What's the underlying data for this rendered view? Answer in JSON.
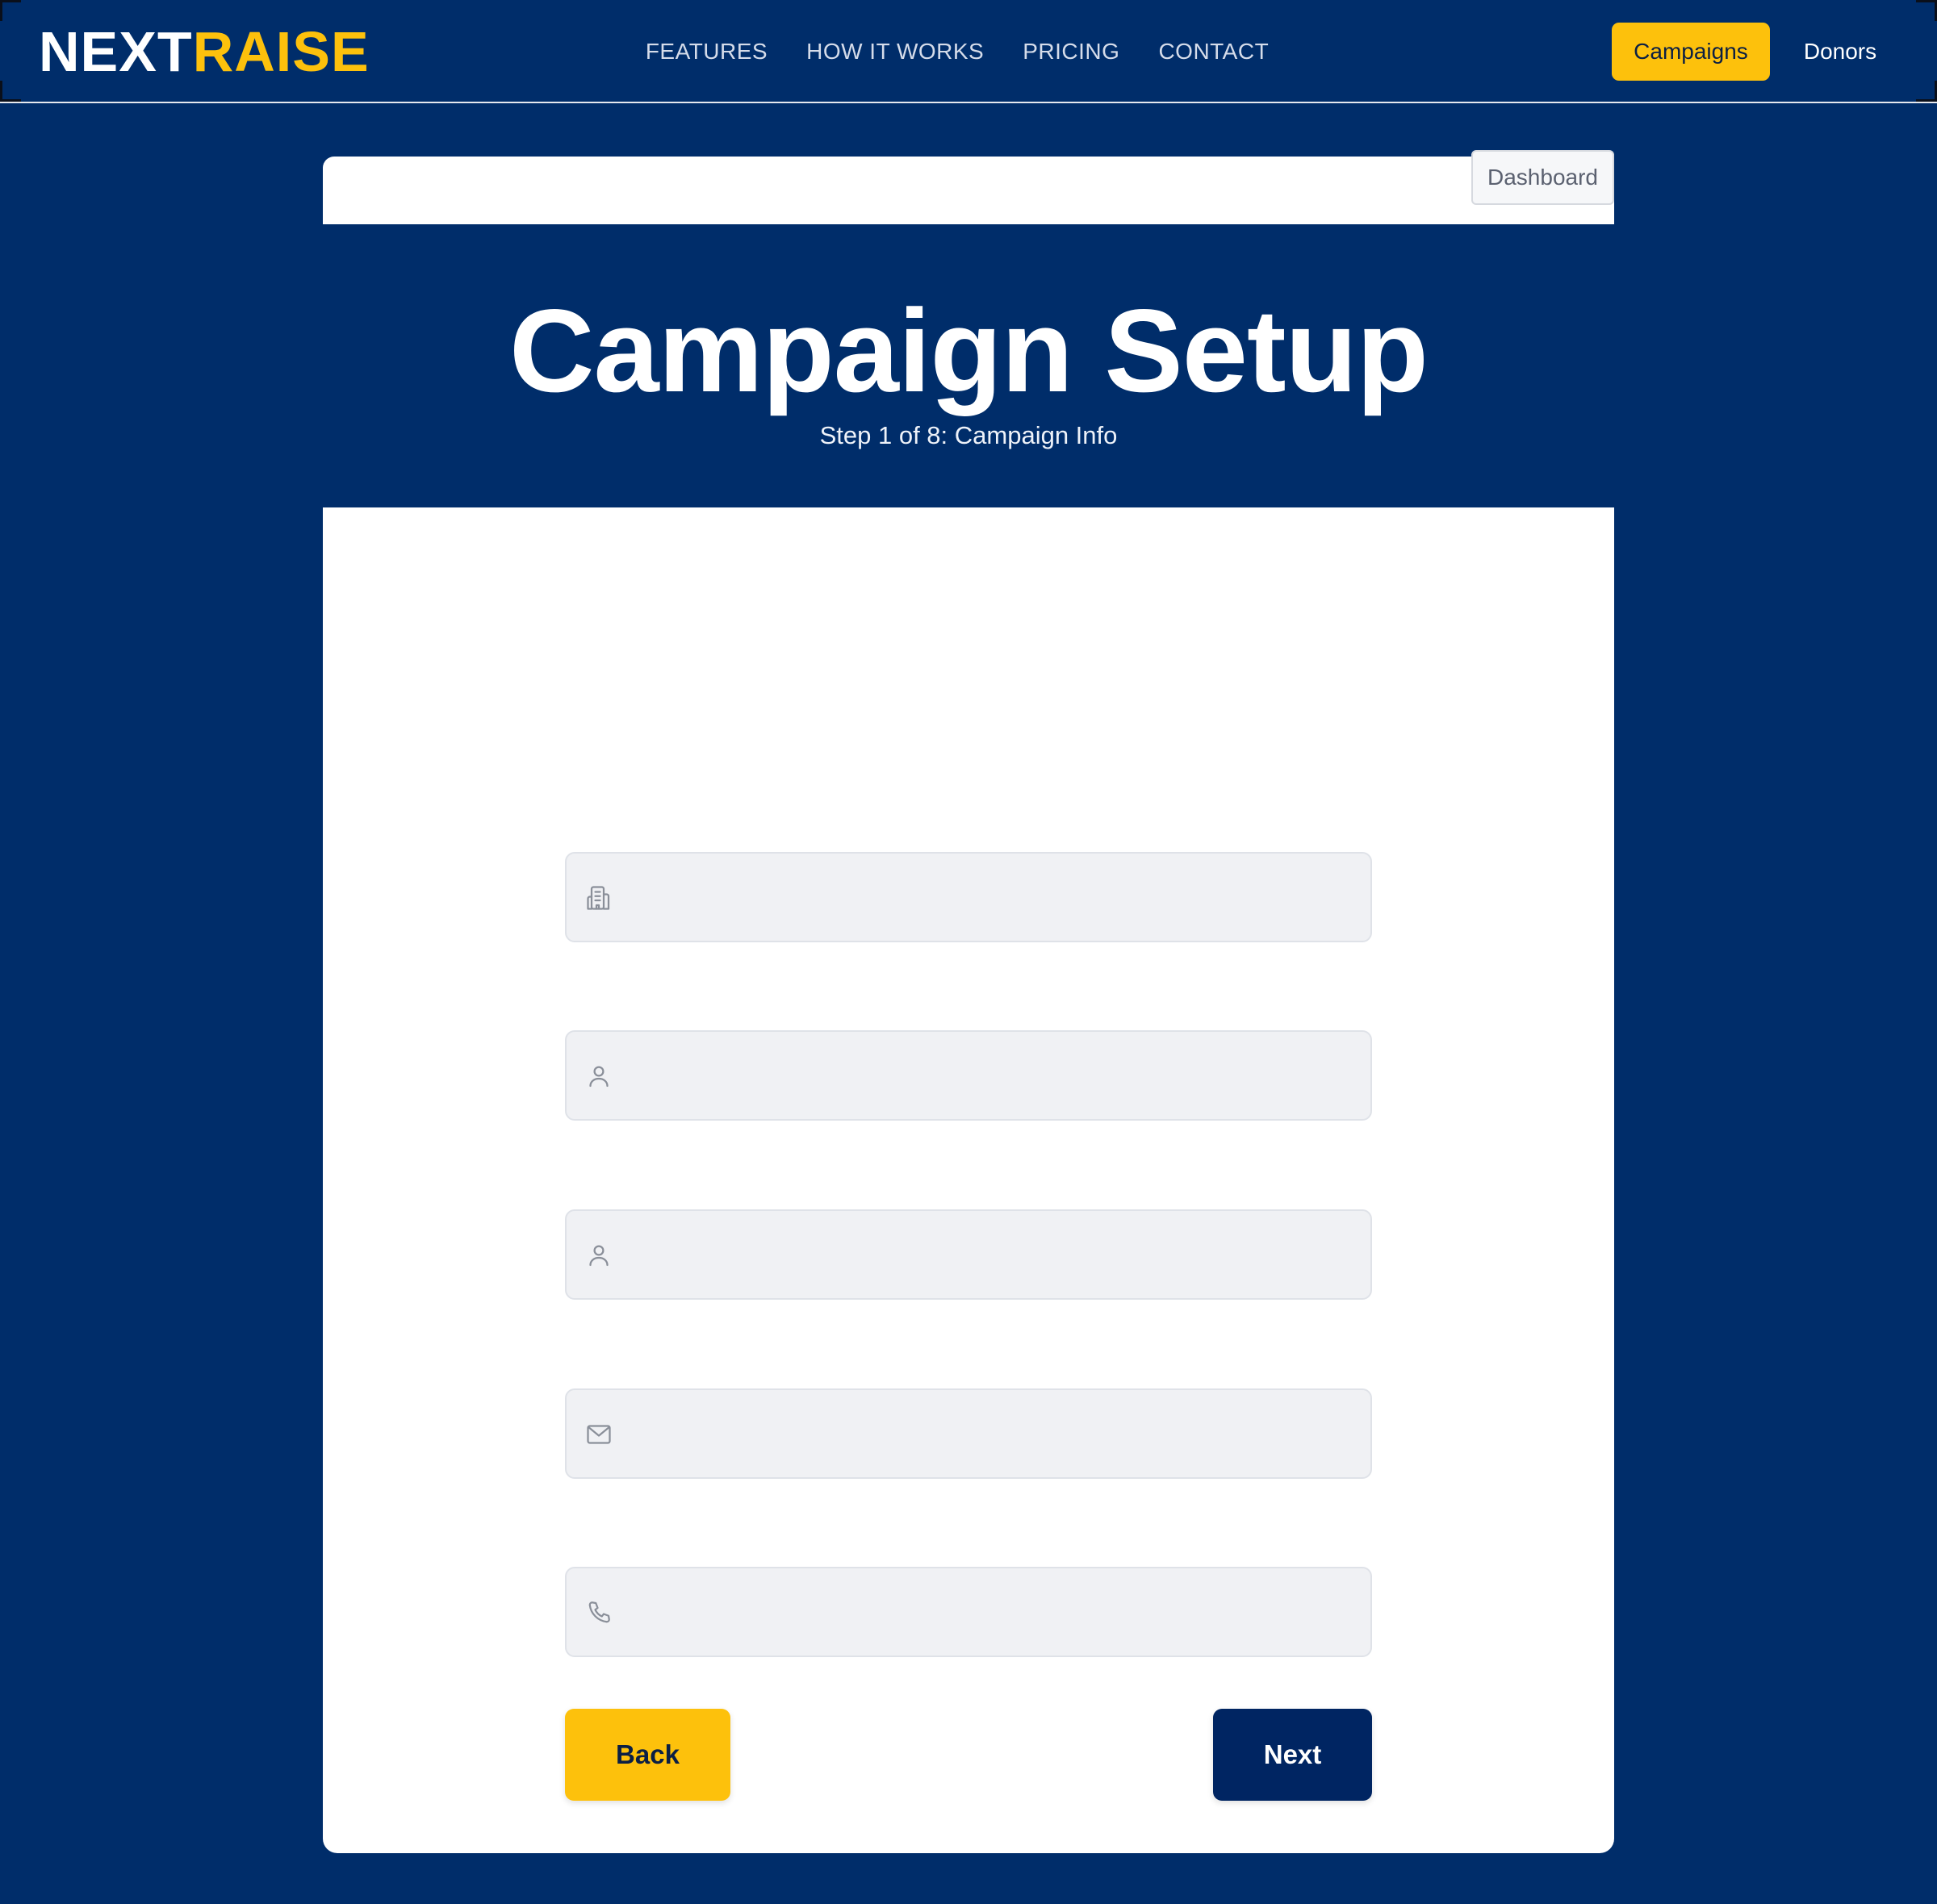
{
  "brand": {
    "part1": "NEXT",
    "part2": "RAISE"
  },
  "nav": {
    "links": [
      "FEATURES",
      "HOW IT WORKS",
      "PRICING",
      "CONTACT"
    ],
    "campaigns_label": "Campaigns",
    "donors_label": "Donors"
  },
  "dashboard_label": "Dashboard",
  "page": {
    "title": "Campaign Setup",
    "subtitle": "Step 1 of 8: Campaign Info"
  },
  "form": {
    "fields": [
      {
        "icon": "building-icon",
        "value": "",
        "placeholder": ""
      },
      {
        "icon": "user-icon",
        "value": "",
        "placeholder": ""
      },
      {
        "icon": "user-icon",
        "value": "",
        "placeholder": ""
      },
      {
        "icon": "mail-icon",
        "value": "",
        "placeholder": ""
      },
      {
        "icon": "phone-icon",
        "value": "",
        "placeholder": ""
      }
    ],
    "back_label": "Back",
    "next_label": "Next"
  },
  "colors": {
    "background": "#002d6a",
    "accent": "#fdc10c",
    "primary_button": "#002562",
    "field_bg": "#f0f1f4"
  }
}
